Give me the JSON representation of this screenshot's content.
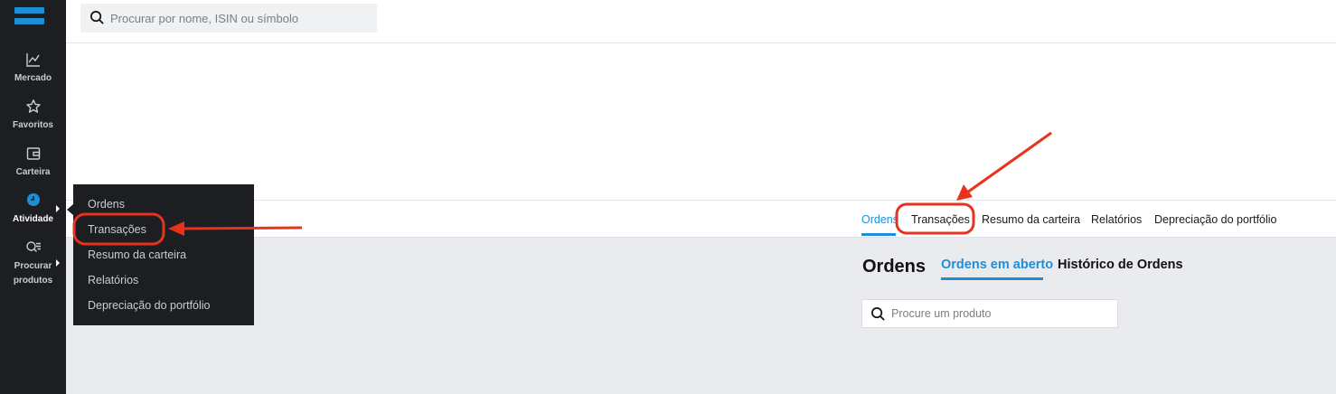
{
  "sidebar": {
    "items": [
      {
        "label": "Mercado"
      },
      {
        "label": "Favoritos"
      },
      {
        "label": "Carteira"
      },
      {
        "label": "Atividade"
      },
      {
        "label": "Procurar produtos"
      }
    ]
  },
  "search": {
    "placeholder": "Procurar por nome, ISIN ou símbolo"
  },
  "flyout": {
    "items": [
      "Ordens",
      "Transações",
      "Resumo da carteira",
      "Relatórios",
      "Depreciação do portfólio"
    ]
  },
  "tabs": [
    "Ordens",
    "Transações",
    "Resumo da carteira",
    "Relatórios",
    "Depreciação do portfólio"
  ],
  "page": {
    "title": "Ordens",
    "subtabs": [
      "Ordens em aberto",
      "Histórico de Ordens"
    ],
    "product_search_placeholder": "Procure um produto"
  },
  "colors": {
    "accent": "#1e8fd6",
    "sidebar_bg": "#1c1e22",
    "annotation": "#e8321b"
  }
}
